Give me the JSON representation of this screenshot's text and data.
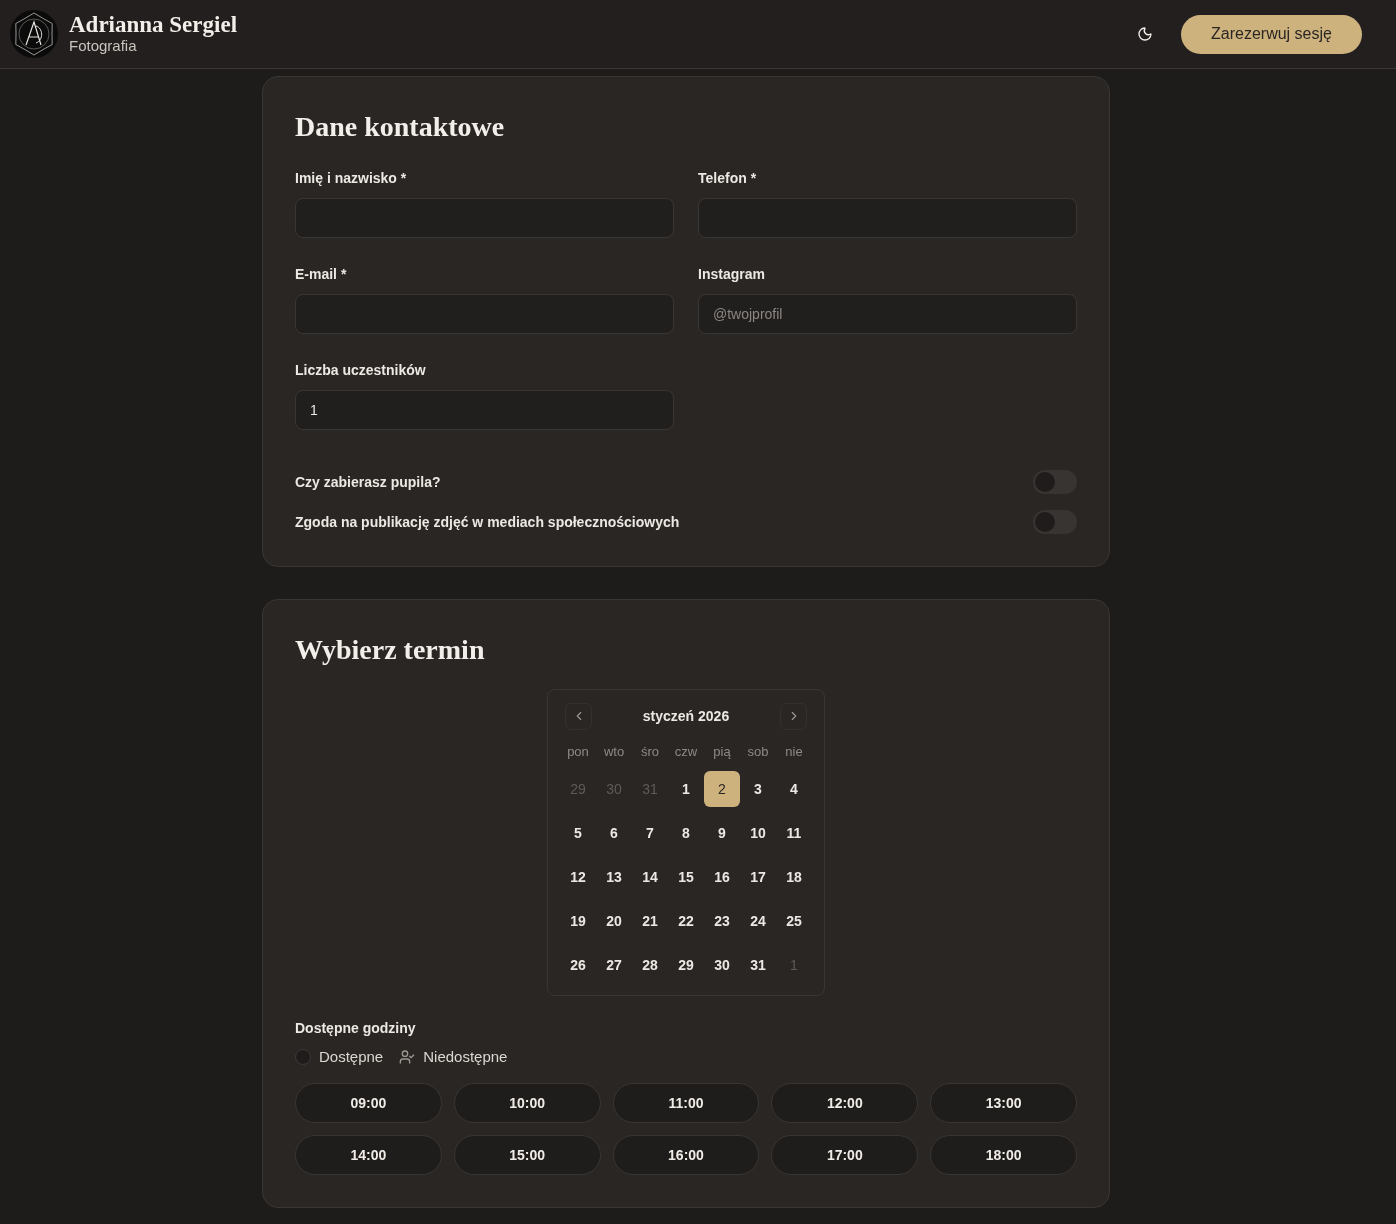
{
  "header": {
    "brand_name": "Adrianna Sergiel",
    "brand_tagline": "Fotografia",
    "cta": "Zarezerwuj sesję"
  },
  "contact_card": {
    "title": "Dane kontaktowe",
    "fields": [
      {
        "label": "Imię i nazwisko *"
      },
      {
        "label": "Telefon *"
      },
      {
        "label": "E-mail *"
      },
      {
        "label": "Instagram",
        "placeholder": "@twojprofil"
      },
      {
        "label": "Liczba uczestników",
        "value": "1"
      }
    ],
    "toggles": [
      {
        "label": "Czy zabierasz pupila?",
        "on": false
      },
      {
        "label": "Zgoda na publikację zdjęć w mediach społecznościowych",
        "on": false
      }
    ]
  },
  "date_card": {
    "title": "Wybierz termin",
    "calendar": {
      "month": "styczeń 2026",
      "weekdays": [
        "pon",
        "wto",
        "śro",
        "czw",
        "pią",
        "sob",
        "nie"
      ],
      "weeks": [
        [
          {
            "day": "29",
            "outside_month": true,
            "selected": false
          },
          {
            "day": "30",
            "outside_month": true,
            "selected": false
          },
          {
            "day": "31",
            "outside_month": true,
            "selected": false
          },
          {
            "day": "1",
            "outside_month": false,
            "selected": false
          },
          {
            "day": "2",
            "outside_month": false,
            "selected": true
          },
          {
            "day": "3",
            "outside_month": false,
            "selected": false
          },
          {
            "day": "4",
            "outside_month": false,
            "selected": false
          }
        ],
        [
          {
            "day": "5",
            "outside_month": false,
            "selected": false
          },
          {
            "day": "6",
            "outside_month": false,
            "selected": false
          },
          {
            "day": "7",
            "outside_month": false,
            "selected": false
          },
          {
            "day": "8",
            "outside_month": false,
            "selected": false
          },
          {
            "day": "9",
            "outside_month": false,
            "selected": false
          },
          {
            "day": "10",
            "outside_month": false,
            "selected": false
          },
          {
            "day": "11",
            "outside_month": false,
            "selected": false
          }
        ],
        [
          {
            "day": "12",
            "outside_month": false,
            "selected": false
          },
          {
            "day": "13",
            "outside_month": false,
            "selected": false
          },
          {
            "day": "14",
            "outside_month": false,
            "selected": false
          },
          {
            "day": "15",
            "outside_month": false,
            "selected": false
          },
          {
            "day": "16",
            "outside_month": false,
            "selected": false
          },
          {
            "day": "17",
            "outside_month": false,
            "selected": false
          },
          {
            "day": "18",
            "outside_month": false,
            "selected": false
          }
        ],
        [
          {
            "day": "19",
            "outside_month": false,
            "selected": false
          },
          {
            "day": "20",
            "outside_month": false,
            "selected": false
          },
          {
            "day": "21",
            "outside_month": false,
            "selected": false
          },
          {
            "day": "22",
            "outside_month": false,
            "selected": false
          },
          {
            "day": "23",
            "outside_month": false,
            "selected": false
          },
          {
            "day": "24",
            "outside_month": false,
            "selected": false
          },
          {
            "day": "25",
            "outside_month": false,
            "selected": false
          }
        ],
        [
          {
            "day": "26",
            "outside_month": false,
            "selected": false
          },
          {
            "day": "27",
            "outside_month": false,
            "selected": false
          },
          {
            "day": "28",
            "outside_month": false,
            "selected": false
          },
          {
            "day": "29",
            "outside_month": false,
            "selected": false
          },
          {
            "day": "30",
            "outside_month": false,
            "selected": false
          },
          {
            "day": "31",
            "outside_month": false,
            "selected": false
          },
          {
            "day": "1",
            "outside_month": true,
            "selected": false
          }
        ]
      ]
    },
    "hours_label": "Dostępne godziny",
    "legend": [
      {
        "kind": "available",
        "label": "Dostępne"
      },
      {
        "kind": "unavailable",
        "label": "Niedostępne"
      }
    ],
    "slots": [
      {
        "time": "09:00",
        "selected": false
      },
      {
        "time": "10:00",
        "selected": false
      },
      {
        "time": "11:00",
        "selected": false
      },
      {
        "time": "12:00",
        "selected": false
      },
      {
        "time": "13:00",
        "selected": false
      },
      {
        "time": "14:00",
        "selected": false
      },
      {
        "time": "15:00",
        "selected": false
      },
      {
        "time": "16:00",
        "selected": false
      },
      {
        "time": "17:00",
        "selected": false
      },
      {
        "time": "18:00",
        "selected": false
      }
    ]
  }
}
